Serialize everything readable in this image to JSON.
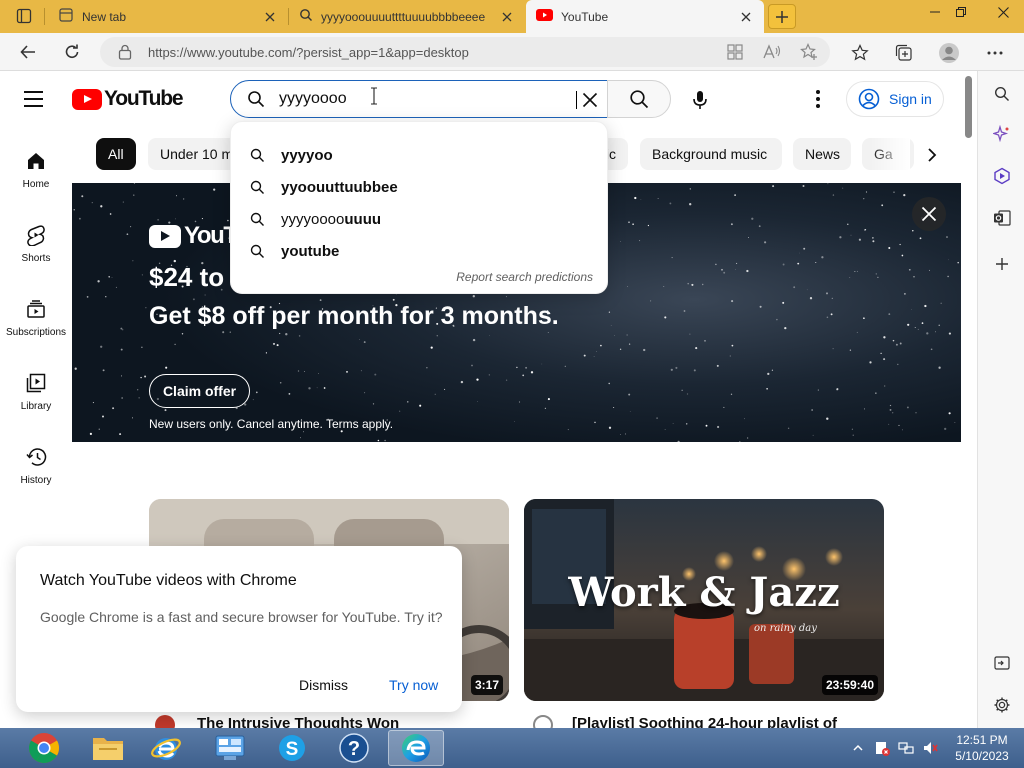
{
  "browser": {
    "tabs": [
      {
        "title": "New tab"
      },
      {
        "title": "yyyyooouuuuttttuuuubbbbeeee"
      },
      {
        "title": "YouTube"
      }
    ],
    "url": "https://www.youtube.com/?persist_app=1&app=desktop"
  },
  "youtube": {
    "logo_text": "YouTube",
    "search": {
      "value": "yyyyoooo"
    },
    "signin_label": "Sign in",
    "guide": [
      {
        "label": "Home",
        "icon": "home-icon"
      },
      {
        "label": "Shorts",
        "icon": "shorts-icon"
      },
      {
        "label": "Subscriptions",
        "icon": "subscriptions-icon"
      },
      {
        "label": "Library",
        "icon": "library-icon"
      },
      {
        "label": "History",
        "icon": "history-icon"
      }
    ],
    "chips": [
      "All",
      "Under 10 m",
      "ic",
      "Background music",
      "News",
      "Ga"
    ],
    "suggestions": [
      {
        "prefix": "",
        "bold": "yyyyoo"
      },
      {
        "prefix": "",
        "bold": "yyoouuttuubbee"
      },
      {
        "prefix": "yyyyoooo",
        "bold": "uuuu"
      },
      {
        "prefix": "",
        "bold": "youtube"
      }
    ],
    "report_label": "Report search predictions",
    "banner": {
      "logo_text": "YouTu",
      "price": "$24 to",
      "offer": "Get $8 off per month for 3 months.",
      "cta": "Claim offer",
      "terms": "New users only. Cancel anytime. Terms apply."
    },
    "videos": [
      {
        "title": "The Intrusive Thoughts Won",
        "duration": "3:17"
      },
      {
        "title": "[Playlist] Soothing 24-hour playlist of",
        "duration": "23:59:40",
        "thumb_text": "Work & Jazz",
        "thumb_sub": "on rainy day"
      }
    ],
    "promo": {
      "title": "Watch YouTube videos with Chrome",
      "body": "Google Chrome is a fast and secure browser for YouTube. Try it?",
      "dismiss": "Dismiss",
      "try": "Try now"
    }
  },
  "taskbar": {
    "time": "12:51 PM",
    "date": "5/10/2023",
    "apps": [
      "chrome-icon",
      "file-explorer-icon",
      "internet-explorer-icon",
      "control-panel-icon",
      "skype-icon",
      "help-icon",
      "edge-icon"
    ]
  },
  "colors": {
    "brand_red": "#ff0000",
    "link_blue": "#065fd4",
    "edge_tab_bg": "#e8b845"
  }
}
